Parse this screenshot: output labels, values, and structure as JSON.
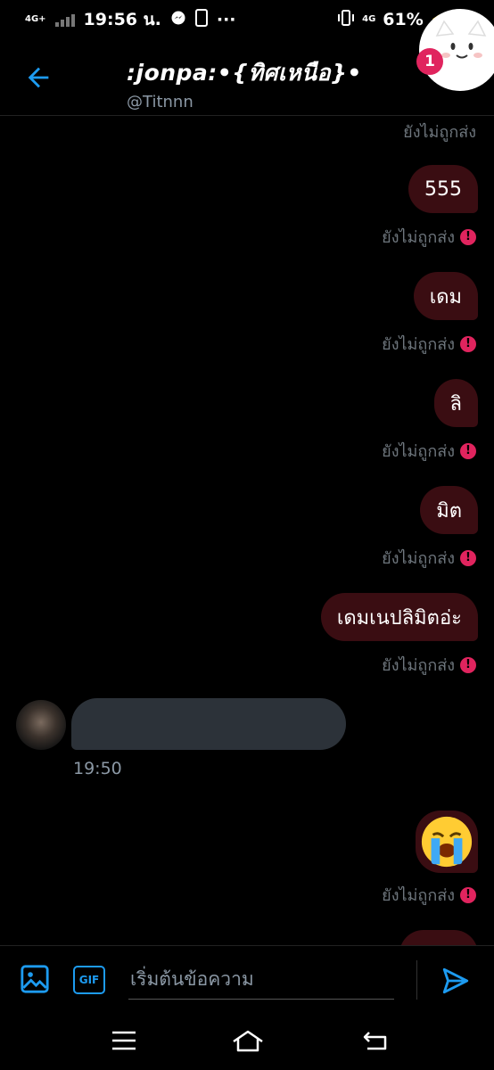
{
  "status_bar": {
    "network_left": "4G+",
    "time": "19:56 น.",
    "network_right": "4G",
    "battery": "61%",
    "battery_level": 0.61,
    "colors": {
      "battery_fill": "#3ecf4a",
      "charge": "#f5c518"
    }
  },
  "header": {
    "title": ":jonpa:•{ทิศเหนือ}•",
    "handle": "@Titnnn",
    "notification_count": "1",
    "back_icon": "arrow-left-icon"
  },
  "messages": {
    "status_text": "ยังไม่ถูกส่ง",
    "sent": [
      {
        "text": "555"
      },
      {
        "text": "เดม"
      },
      {
        "text": "ลิ"
      },
      {
        "text": "มิต"
      },
      {
        "text": "เดมเนปลิมิตอ่ะ"
      }
    ],
    "received": {
      "time": "19:50"
    },
    "emoji": "crying-face"
  },
  "composer": {
    "placeholder": "เริ่มต้นข้อความ",
    "gif_label": "GIF",
    "icons": [
      "image-icon",
      "gif-icon",
      "send-icon"
    ]
  },
  "nav": {
    "icons": [
      "menu-icon",
      "home-icon",
      "back-icon"
    ]
  },
  "colors": {
    "accent": "#1d9bf0",
    "sent_bubble": "#3a0d12",
    "error": "#e0245e",
    "received_bubble": "#2c3239"
  }
}
